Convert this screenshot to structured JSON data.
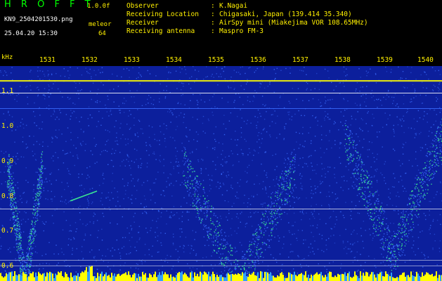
{
  "header": {
    "app_title": "H R O F F T",
    "version": "1.0.0f",
    "filename": "KN9_2504201530.png",
    "station": "meleor",
    "datetime": "25.04.20 15:30",
    "count": "64",
    "info": [
      {
        "key": "Observer",
        "value": "K.Nagai"
      },
      {
        "key": "Receiving Location",
        "value": "Chigasaki, Japan (139.414 35.340)"
      },
      {
        "key": "Receiver",
        "value": "AirSpy mini (Miakejima VOR 108.65MHz)"
      },
      {
        "key": "Receiving antenna",
        "value": "Maspro FM-3"
      }
    ]
  },
  "axis": {
    "unit": "kHz",
    "time_ticks": [
      "1531",
      "1532",
      "1533",
      "1534",
      "1535",
      "1536",
      "1537",
      "1538",
      "1539",
      "1540"
    ],
    "freq_ticks": [
      "1.1",
      "1.0",
      "0.9",
      "0.8",
      "0.7",
      "0.6"
    ]
  },
  "colors": {
    "background": "#0c1f9c",
    "noise": "#3a6cff",
    "signal": "#40ff90",
    "carrier": "#ffffff",
    "hot": "#ffff00"
  }
}
